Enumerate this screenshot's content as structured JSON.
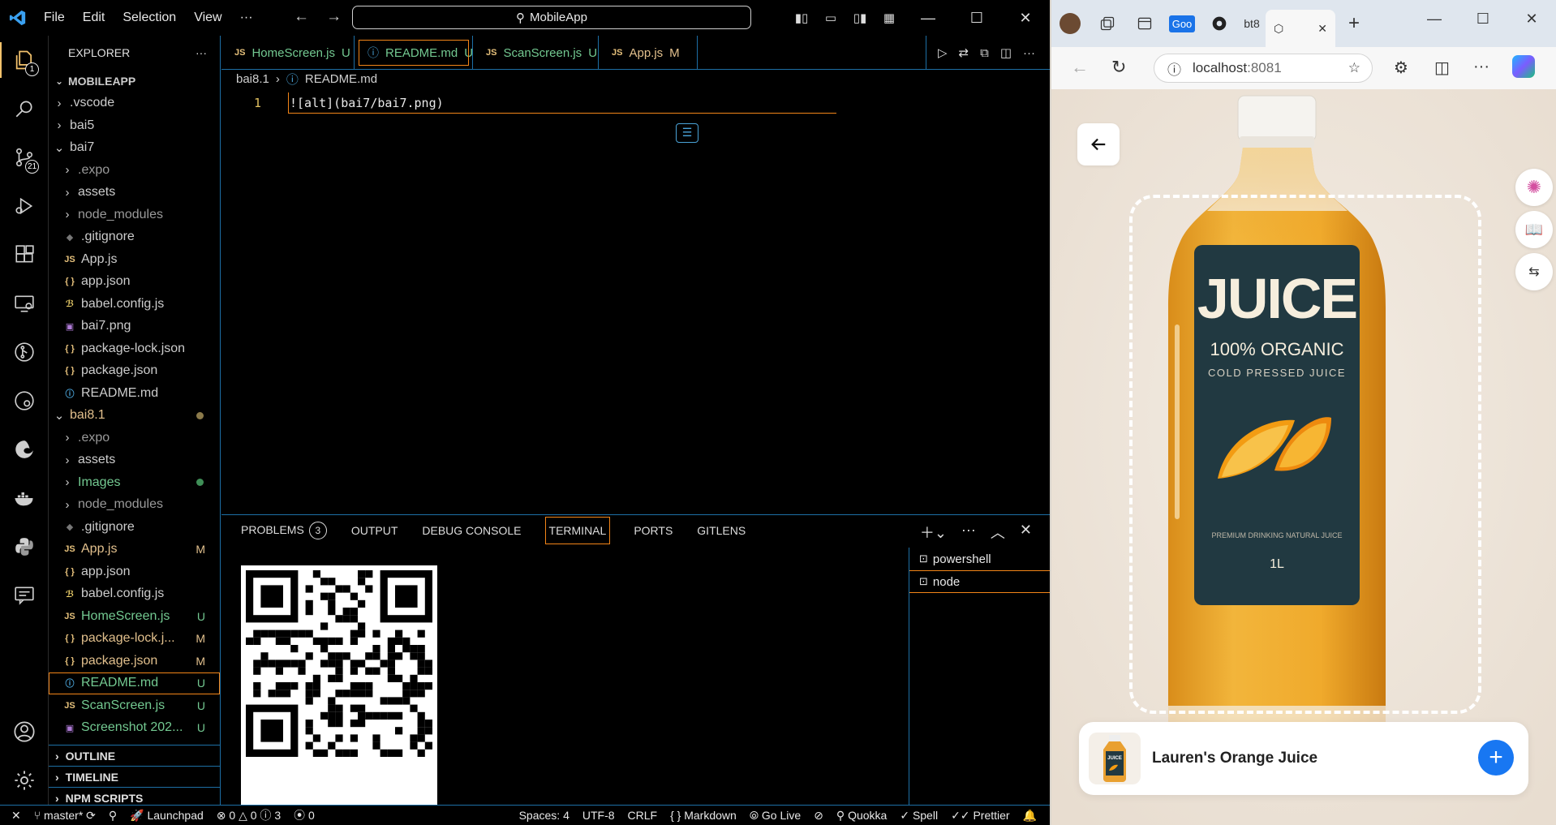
{
  "vscode": {
    "menu": [
      "File",
      "Edit",
      "Selection",
      "View",
      "···"
    ],
    "command_center": "MobileApp",
    "explorer_title": "EXPLORER",
    "project": "MOBILEAPP",
    "activity_badges": {
      "explorer": "1",
      "source_control": "21"
    },
    "tree": [
      {
        "label": ".vscode",
        "type": "folder",
        "indent": 1,
        "open": false
      },
      {
        "label": "bai5",
        "type": "folder",
        "indent": 1,
        "open": false
      },
      {
        "label": "bai7",
        "type": "folder",
        "indent": 1,
        "open": true
      },
      {
        "label": ".expo",
        "type": "folder",
        "indent": 2,
        "open": false
      },
      {
        "label": "assets",
        "type": "folder",
        "indent": 2,
        "open": false
      },
      {
        "label": "node_modules",
        "type": "folder",
        "indent": 2,
        "open": false
      },
      {
        "label": ".gitignore",
        "type": "git",
        "indent": 2
      },
      {
        "label": "App.js",
        "type": "js",
        "indent": 2
      },
      {
        "label": "app.json",
        "type": "json",
        "indent": 2
      },
      {
        "label": "babel.config.js",
        "type": "babel",
        "indent": 2
      },
      {
        "label": "bai7.png",
        "type": "image",
        "indent": 2
      },
      {
        "label": "package-lock.json",
        "type": "json",
        "indent": 2
      },
      {
        "label": "package.json",
        "type": "json",
        "indent": 2
      },
      {
        "label": "README.md",
        "type": "info",
        "indent": 2
      },
      {
        "label": "bai8.1",
        "type": "folder",
        "indent": 1,
        "open": true,
        "color": "#e2c08d",
        "dot": "#8b7a4a"
      },
      {
        "label": ".expo",
        "type": "folder",
        "indent": 2,
        "open": false
      },
      {
        "label": "assets",
        "type": "folder",
        "indent": 2,
        "open": false
      },
      {
        "label": "Images",
        "type": "folder",
        "indent": 2,
        "open": false,
        "color": "#73c991",
        "dot": "#3f8f57"
      },
      {
        "label": "node_modules",
        "type": "folder",
        "indent": 2,
        "open": false
      },
      {
        "label": ".gitignore",
        "type": "git",
        "indent": 2
      },
      {
        "label": "App.js",
        "type": "js",
        "indent": 2,
        "color": "#e2c08d",
        "badge": "M"
      },
      {
        "label": "app.json",
        "type": "json",
        "indent": 2
      },
      {
        "label": "babel.config.js",
        "type": "babel",
        "indent": 2
      },
      {
        "label": "HomeScreen.js",
        "type": "js",
        "indent": 2,
        "color": "#73c991",
        "badge": "U"
      },
      {
        "label": "package-lock.j...",
        "type": "json",
        "indent": 2,
        "color": "#e2c08d",
        "badge": "M"
      },
      {
        "label": "package.json",
        "type": "json",
        "indent": 2,
        "color": "#e2c08d",
        "badge": "M"
      },
      {
        "label": "README.md",
        "type": "info",
        "indent": 2,
        "color": "#73c991",
        "badge": "U",
        "selected": true
      },
      {
        "label": "ScanScreen.js",
        "type": "js",
        "indent": 2,
        "color": "#73c991",
        "badge": "U"
      },
      {
        "label": "Screenshot 202...",
        "type": "image",
        "indent": 2,
        "color": "#73c991",
        "badge": "U"
      }
    ],
    "sections": [
      "OUTLINE",
      "TIMELINE",
      "NPM SCRIPTS"
    ],
    "tabs": [
      {
        "label": "HomeScreen.js",
        "icon": "JS",
        "status": "U",
        "color": "#73c991",
        "width": 164
      },
      {
        "label": "README.md",
        "icon": "ⓘ",
        "status": "U",
        "color": "#73c991",
        "width": 146,
        "active": true,
        "dirty": true
      },
      {
        "label": "ScanScreen.js",
        "icon": "JS",
        "status": "U",
        "color": "#73c991",
        "width": 155
      },
      {
        "label": "App.js",
        "icon": "JS",
        "status": "M",
        "color": "#e2c08d",
        "width": 122
      }
    ],
    "breadcrumb": [
      "bai8.1",
      "README.md"
    ],
    "code": {
      "line_number": "1",
      "text": "![alt](bai7/bai7.png)"
    },
    "panel": {
      "tabs": [
        "PROBLEMS",
        "OUTPUT",
        "DEBUG CONSOLE",
        "TERMINAL",
        "PORTS",
        "GITLENS"
      ],
      "problems_count": "3",
      "active_tab": "TERMINAL",
      "terminals": [
        "powershell",
        "node"
      ]
    },
    "status": {
      "branch": "master*",
      "launchpad": "Launchpad",
      "errors": "0",
      "warnings": "0",
      "info": "3",
      "ports": "0",
      "spaces": "Spaces: 4",
      "encoding": "UTF-8",
      "eol": "CRLF",
      "language": "Markdown",
      "golive": "Go Live",
      "quokka": "Quokka",
      "spell": "Spell",
      "prettier": "Prettier"
    }
  },
  "browser": {
    "tab_labels": [
      "Goo",
      "bt8"
    ],
    "url_host": "localhost",
    "url_port": ":8081",
    "product": {
      "name": "Lauren's Orange Juice",
      "bottle_label_title": "JUICE",
      "bottle_label_sub": "100% ORGANIC",
      "bottle_label_sub2": "COLD PRESSED JUICE",
      "bottle_label_small": "PREMIUM DRINKING NATURAL JUICE",
      "bottle_volume": "1L",
      "thumb_text": "JUICE"
    },
    "add_label": "+"
  },
  "colors": {
    "accent_orange": "#f38518",
    "accent_blue": "#1d6fa5",
    "modified": "#e2c08d",
    "untracked": "#73c991",
    "add_button": "#1877f2"
  }
}
